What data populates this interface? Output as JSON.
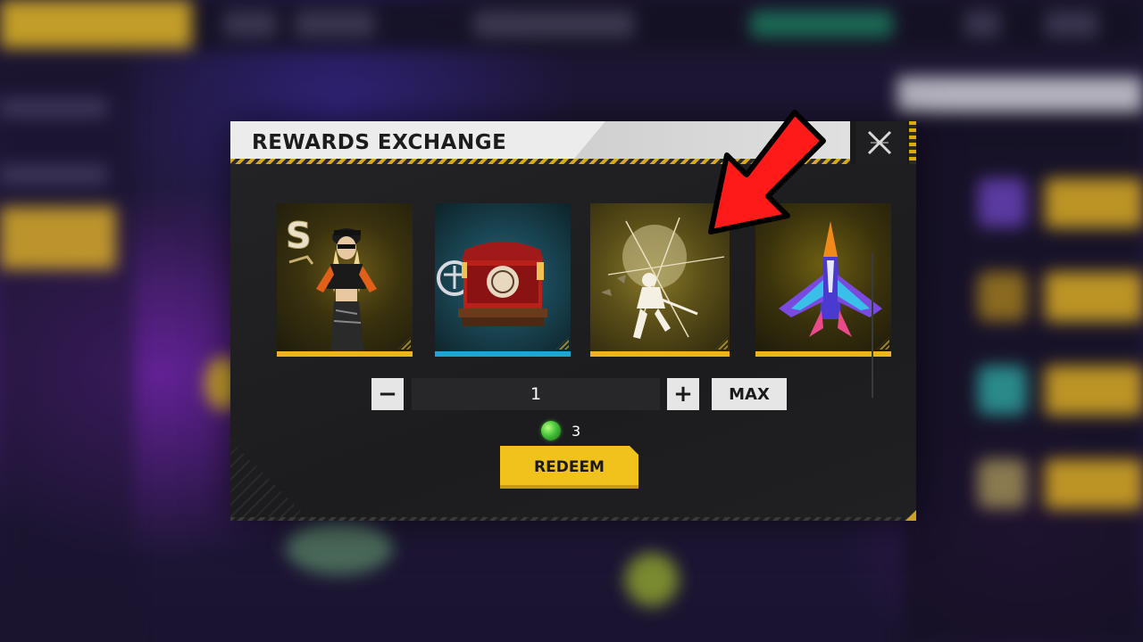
{
  "modal": {
    "title": "REWARDS EXCHANGE",
    "close_icon": "close-x-icon"
  },
  "rewards": [
    {
      "name": "character-outfit",
      "icon": "female-character-outfit-icon",
      "bar_color": "#f2b21c"
    },
    {
      "name": "stage-item",
      "icon": "stage-booth-icon",
      "bar_color": "#1fa3d9"
    },
    {
      "name": "emote-item",
      "icon": "katana-emote-icon",
      "bar_color": "#f2b21c"
    },
    {
      "name": "glider-skin",
      "icon": "jet-glider-icon",
      "bar_color": "#f2b21c"
    }
  ],
  "counter": {
    "minus_label": "−",
    "quantity": "1",
    "plus_label": "+",
    "max_label": "MAX"
  },
  "cost": {
    "currency_icon": "green-gem-icon",
    "amount": "3"
  },
  "redeem_label": "REDEEM",
  "annotation": {
    "arrow_icon": "red-arrow-icon",
    "arrow_color": "#ff1a1a"
  }
}
